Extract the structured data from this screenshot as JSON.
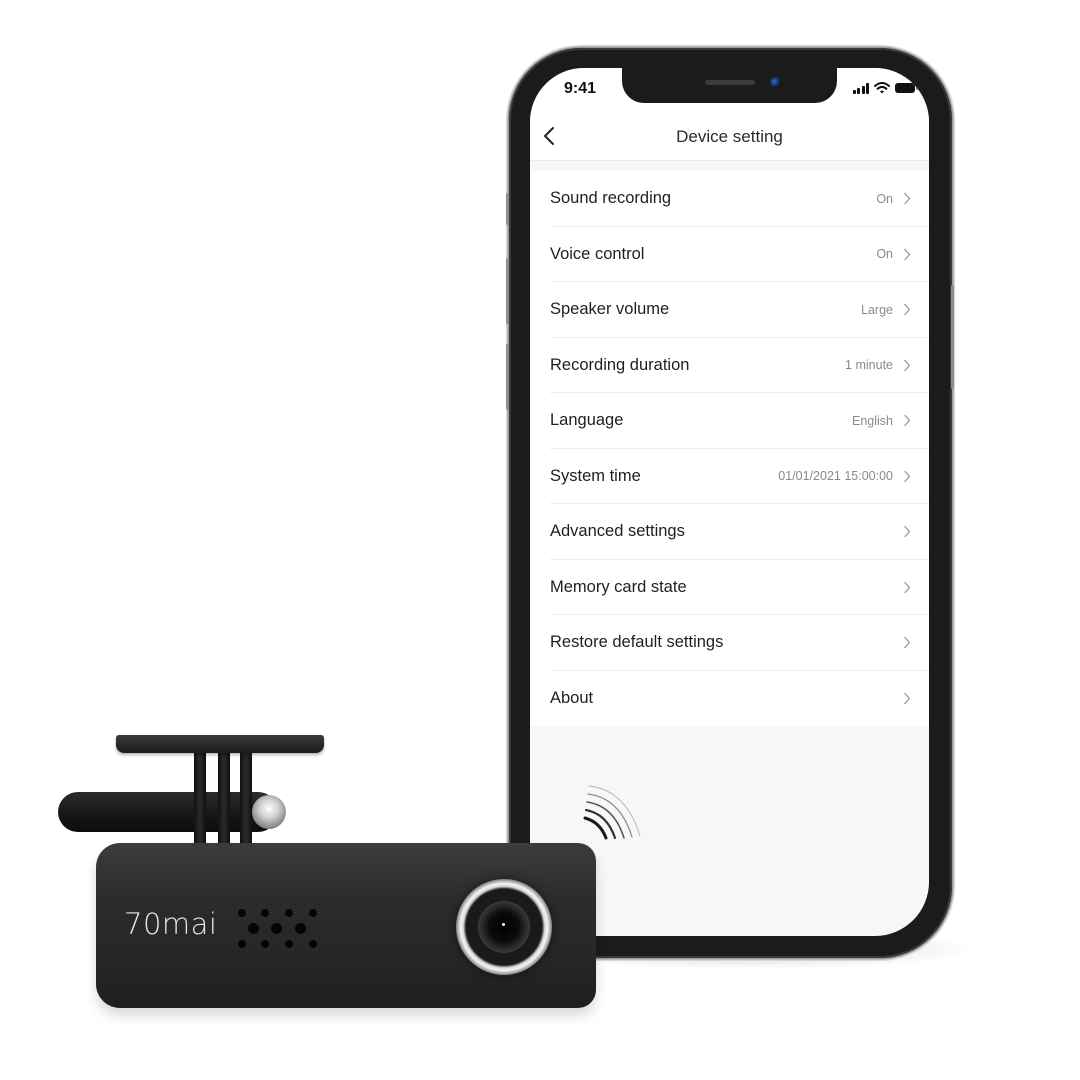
{
  "status_bar": {
    "time": "9:41",
    "icons": [
      "cellular-signal-icon",
      "wifi-icon",
      "battery-icon"
    ]
  },
  "navbar": {
    "back_icon": "chevron-left-icon",
    "title": "Device setting"
  },
  "settings": [
    {
      "label": "Sound recording",
      "value": "On"
    },
    {
      "label": "Voice control",
      "value": "On"
    },
    {
      "label": "Speaker volume",
      "value": "Large"
    },
    {
      "label": "Recording duration",
      "value": "1 minute"
    },
    {
      "label": "Language",
      "value": "English"
    },
    {
      "label": "System time",
      "value": "01/01/2021 15:00:00"
    },
    {
      "label": "Advanced settings",
      "value": ""
    },
    {
      "label": "Memory card state",
      "value": ""
    },
    {
      "label": "Restore default settings",
      "value": ""
    },
    {
      "label": "About",
      "value": ""
    }
  ],
  "decor": {
    "voice_icon": "voice-waves-icon"
  },
  "dashcam": {
    "brand": "70mai"
  },
  "colors": {
    "screen_bg": "#f6f7f9",
    "list_bg": "#ffffff",
    "text_primary": "#1f1f1f",
    "text_secondary": "#8a8a8c",
    "divider": "#eceef1",
    "device_body": "#2c2c2e"
  }
}
